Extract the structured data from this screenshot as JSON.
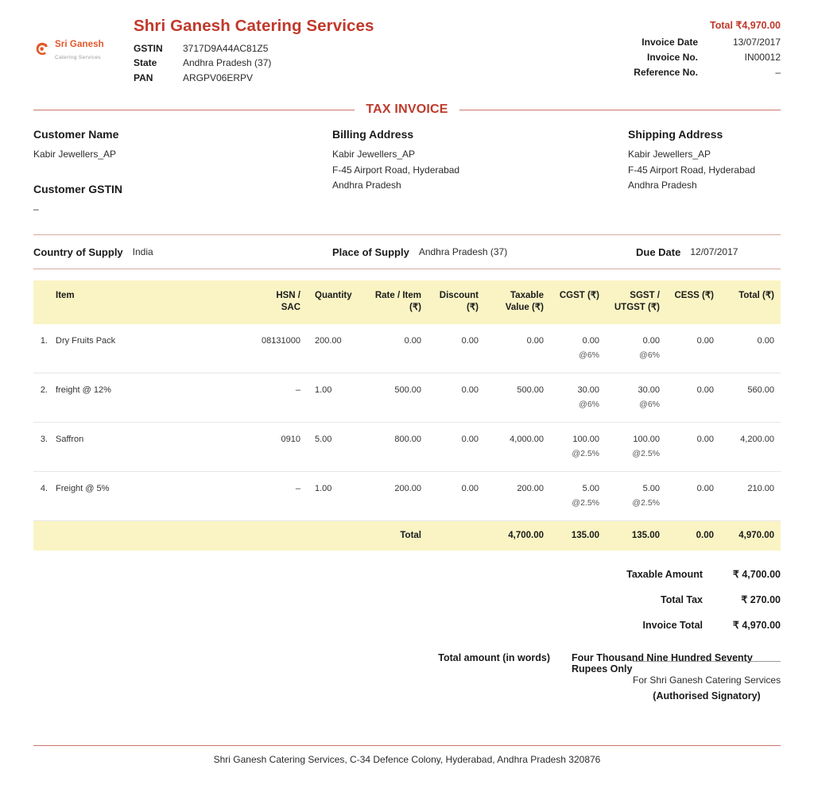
{
  "company": {
    "name": "Shri Ganesh Catering Services",
    "logo_name": "Sri Ganesh",
    "logo_sub": "Catering Services",
    "fields": [
      {
        "label": "GSTIN",
        "value": "3717D9A44AC81Z5"
      },
      {
        "label": "State",
        "value": "Andhra Pradesh (37)"
      },
      {
        "label": "PAN",
        "value": "ARGPV06ERPV"
      }
    ]
  },
  "meta": {
    "total_label": "Total ₹4,970.00",
    "rows": [
      {
        "label": "Invoice Date",
        "value": "13/07/2017"
      },
      {
        "label": "Invoice No.",
        "value": "IN00012"
      },
      {
        "label": "Reference No.",
        "value": "–"
      }
    ]
  },
  "doc_title": "TAX INVOICE",
  "customer": {
    "name_heading": "Customer Name",
    "name_value": "Kabir Jewellers_AP",
    "gstin_heading": "Customer GSTIN",
    "gstin_value": "–",
    "billing_heading": "Billing Address",
    "billing_lines": [
      "Kabir Jewellers_AP",
      "F-45 Airport Road, Hyderabad",
      "Andhra Pradesh"
    ],
    "shipping_heading": "Shipping Address",
    "shipping_lines": [
      "Kabir Jewellers_AP",
      "F-45 Airport Road, Hyderabad",
      "Andhra Pradesh"
    ]
  },
  "supply": {
    "country_label": "Country of Supply",
    "country_value": "India",
    "place_label": "Place of Supply",
    "place_value": "Andhra Pradesh (37)",
    "due_label": "Due Date",
    "due_value": "12/07/2017"
  },
  "table": {
    "headers": {
      "item": "Item",
      "hsn": "HSN / SAC",
      "quantity": "Quantity",
      "rate": "Rate / Item (₹)",
      "discount": "Discount (₹)",
      "taxable": "Taxable Value (₹)",
      "cgst": "CGST (₹)",
      "sgst": "SGST / UTGST (₹)",
      "cess": "CESS (₹)",
      "total": "Total (₹)"
    },
    "rows": [
      {
        "num": "1.",
        "item": "Dry Fruits Pack",
        "hsn": "08131000",
        "quantity": "200.00",
        "rate": "0.00",
        "discount": "0.00",
        "taxable": "0.00",
        "cgst": "0.00",
        "cgst_rate": "@6%",
        "sgst": "0.00",
        "sgst_rate": "@6%",
        "cess": "0.00",
        "total": "0.00"
      },
      {
        "num": "2.",
        "item": "freight @ 12%",
        "hsn": "–",
        "quantity": "1.00",
        "rate": "500.00",
        "discount": "0.00",
        "taxable": "500.00",
        "cgst": "30.00",
        "cgst_rate": "@6%",
        "sgst": "30.00",
        "sgst_rate": "@6%",
        "cess": "0.00",
        "total": "560.00"
      },
      {
        "num": "3.",
        "item": "Saffron",
        "hsn": "0910",
        "quantity": "5.00",
        "rate": "800.00",
        "discount": "0.00",
        "taxable": "4,000.00",
        "cgst": "100.00",
        "cgst_rate": "@2.5%",
        "sgst": "100.00",
        "sgst_rate": "@2.5%",
        "cess": "0.00",
        "total": "4,200.00"
      },
      {
        "num": "4.",
        "item": "Freight @ 5%",
        "hsn": "–",
        "quantity": "1.00",
        "rate": "200.00",
        "discount": "0.00",
        "taxable": "200.00",
        "cgst": "5.00",
        "cgst_rate": "@2.5%",
        "sgst": "5.00",
        "sgst_rate": "@2.5%",
        "cess": "0.00",
        "total": "210.00"
      }
    ],
    "total_row": {
      "label": "Total",
      "taxable": "4,700.00",
      "cgst": "135.00",
      "sgst": "135.00",
      "cess": "0.00",
      "total": "4,970.00"
    }
  },
  "summary": {
    "rows": [
      {
        "label": "Taxable Amount",
        "value": "₹ 4,700.00"
      },
      {
        "label": "Total Tax",
        "value": "₹ 270.00"
      },
      {
        "label": "Invoice Total",
        "value": "₹ 4,970.00"
      }
    ],
    "words_label": "Total amount (in words)",
    "words_value": "Four Thousand Nine Hundred Seventy Rupees Only"
  },
  "signature": {
    "for_line": "For Shri Ganesh Catering Services",
    "authorised": "(Authorised Signatory)"
  },
  "footer": {
    "text": "Shri Ganesh Catering Services, C-34 Defence Colony, Hyderabad, Andhra Pradesh 320876"
  },
  "colors": {
    "accent_red": "#c0392b",
    "rule_rose": "#c9776a",
    "table_header_bg": "#faf4c4",
    "logo_orange": "#e2582a"
  }
}
